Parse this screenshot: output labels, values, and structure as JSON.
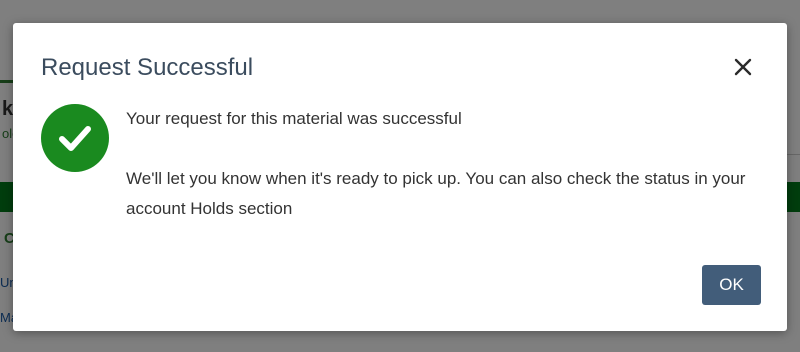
{
  "background": {
    "heading_fragment": "k",
    "sub_fragment": "ole",
    "section_fragment": "C",
    "link1_fragment": "Un",
    "link2_fragment": "Ma"
  },
  "modal": {
    "title": "Request Successful",
    "close_icon": "close-icon",
    "status_icon": "check-circle-icon",
    "status_color": "#1a8a1f",
    "message": "Your request for this material was successful",
    "detail": "We'll let you know when it's ready to pick up. You can also check the status in your account Holds section",
    "ok_label": "OK",
    "ok_color": "#425d7a"
  }
}
